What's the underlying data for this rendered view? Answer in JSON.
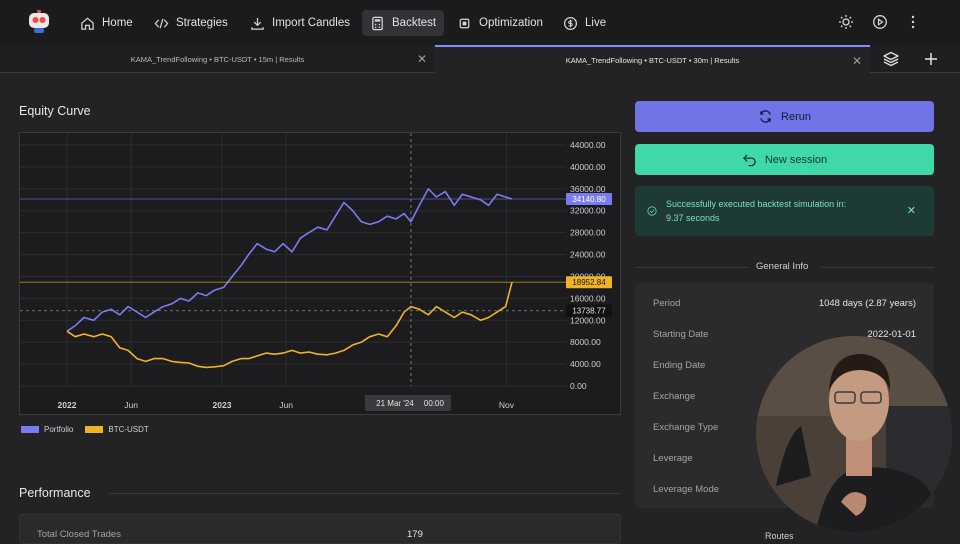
{
  "nav": {
    "home": "Home",
    "strategies": "Strategies",
    "import_candles": "Import Candles",
    "backtest": "Backtest",
    "optimization": "Optimization",
    "live": "Live"
  },
  "tabs": [
    {
      "label": "KAMA_TrendFollowing • BTC-USDT • 15m | Results"
    },
    {
      "label": "KAMA_TrendFollowing • BTC-USDT • 30m | Results"
    }
  ],
  "equity": {
    "title": "Equity Curve"
  },
  "performance": {
    "title": "Performance",
    "rows": [
      {
        "label": "Total Closed Trades",
        "value": "179"
      }
    ]
  },
  "actions": {
    "rerun": "Rerun",
    "new_session": "New session"
  },
  "alert": {
    "line1": "Successfully executed backtest simulation in:",
    "line2": "9.37 seconds"
  },
  "general_info": {
    "title": "General Info",
    "rows": [
      {
        "label": "Period",
        "value": "1048 days (2.87 years)"
      },
      {
        "label": "Starting Date",
        "value": "2022-01-01"
      },
      {
        "label": "Ending Date",
        "value": ""
      },
      {
        "label": "Exchange",
        "value": ""
      },
      {
        "label": "Exchange Type",
        "value": ""
      },
      {
        "label": "Leverage",
        "value": ""
      },
      {
        "label": "Leverage Mode",
        "value": ""
      }
    ]
  },
  "routes": {
    "title": "Routes"
  },
  "colors": {
    "portfolio": "#7b7bf0",
    "btc": "#f0b323",
    "accent_green": "#3fd8a8",
    "accent_purple": "#7074e6"
  },
  "chart_data": {
    "type": "line",
    "x_ticks": [
      "2022",
      "Jun",
      "2023",
      "Jun",
      "21 Mar '24",
      "00:00",
      "Nov"
    ],
    "y_ticks": [
      "44000.00",
      "40000.00",
      "36000.00",
      "32000.00",
      "28000.00",
      "24000.00",
      "20000.00",
      "16000.00",
      "12000.00",
      "8000.00",
      "4000.00",
      "0.00"
    ],
    "ylim": [
      0,
      44000
    ],
    "x_range": [
      "2022-01-01",
      "2024-11-14"
    ],
    "crosshair": {
      "x_label": "21 Mar '24",
      "time_label": "00:00",
      "y_label": "13738.77"
    },
    "price_labels": {
      "portfolio": "34140.80",
      "btc": "18952.84"
    },
    "series": [
      {
        "name": "Portfolio",
        "color": "#7b7bf0",
        "dates": [
          "2022-01-01",
          "2022-01-20",
          "2022-02-10",
          "2022-03-05",
          "2022-03-25",
          "2022-04-15",
          "2022-05-05",
          "2022-05-25",
          "2022-06-15",
          "2022-07-05",
          "2022-07-25",
          "2022-08-15",
          "2022-09-05",
          "2022-09-25",
          "2022-10-15",
          "2022-11-05",
          "2022-11-25",
          "2022-12-15",
          "2023-01-05",
          "2023-01-25",
          "2023-02-15",
          "2023-03-05",
          "2023-03-25",
          "2023-04-15",
          "2023-05-05",
          "2023-05-25",
          "2023-06-15",
          "2023-07-05",
          "2023-07-25",
          "2023-08-15",
          "2023-09-05",
          "2023-09-25",
          "2023-10-15",
          "2023-11-05",
          "2023-11-25",
          "2023-12-15",
          "2024-01-05",
          "2024-01-25",
          "2024-02-15",
          "2024-03-05",
          "2024-03-21",
          "2024-04-10",
          "2024-05-01",
          "2024-05-20",
          "2024-06-10",
          "2024-07-01",
          "2024-07-20",
          "2024-08-10",
          "2024-09-01",
          "2024-09-20",
          "2024-10-10",
          "2024-10-30",
          "2024-11-14"
        ],
        "values": [
          10000,
          11000,
          12500,
          12000,
          13500,
          14000,
          13000,
          14500,
          13500,
          12500,
          13500,
          14500,
          15000,
          16000,
          15500,
          17000,
          16500,
          17500,
          18000,
          20000,
          22000,
          24000,
          26000,
          25000,
          24500,
          26000,
          24500,
          27000,
          28000,
          29000,
          28500,
          31000,
          33500,
          32000,
          30000,
          29500,
          30000,
          31000,
          30500,
          31500,
          30000,
          33000,
          36000,
          34500,
          35500,
          33000,
          35000,
          34500,
          34000,
          33000,
          35000,
          34500,
          34140.8
        ]
      },
      {
        "name": "BTC-USDT",
        "color": "#f0b323",
        "dates": [
          "2022-01-01",
          "2022-01-20",
          "2022-02-10",
          "2022-03-05",
          "2022-03-25",
          "2022-04-15",
          "2022-05-05",
          "2022-05-25",
          "2022-06-15",
          "2022-07-05",
          "2022-07-25",
          "2022-08-15",
          "2022-09-05",
          "2022-09-25",
          "2022-10-15",
          "2022-11-05",
          "2022-11-25",
          "2022-12-15",
          "2023-01-05",
          "2023-01-25",
          "2023-02-15",
          "2023-03-05",
          "2023-03-25",
          "2023-04-15",
          "2023-05-05",
          "2023-05-25",
          "2023-06-15",
          "2023-07-05",
          "2023-07-25",
          "2023-08-15",
          "2023-09-05",
          "2023-09-25",
          "2023-10-15",
          "2023-11-05",
          "2023-11-25",
          "2023-12-15",
          "2024-01-05",
          "2024-01-25",
          "2024-02-15",
          "2024-03-05",
          "2024-03-21",
          "2024-04-10",
          "2024-05-01",
          "2024-05-20",
          "2024-06-10",
          "2024-07-01",
          "2024-07-20",
          "2024-08-10",
          "2024-09-01",
          "2024-09-20",
          "2024-10-10",
          "2024-10-30",
          "2024-11-14"
        ],
        "values": [
          10000,
          9000,
          9500,
          9000,
          9500,
          9000,
          7000,
          6500,
          5000,
          4500,
          5000,
          5000,
          4500,
          4300,
          4200,
          3600,
          3400,
          3500,
          3700,
          4500,
          5000,
          5000,
          5500,
          6000,
          5800,
          6000,
          6500,
          6000,
          6200,
          5800,
          5700,
          6000,
          6500,
          7500,
          8000,
          9000,
          9500,
          9000,
          11000,
          13500,
          14500,
          14000,
          13000,
          14500,
          13500,
          12500,
          13500,
          13000,
          12000,
          12500,
          13500,
          14500,
          18952.84
        ]
      }
    ],
    "legend": [
      "Portfolio",
      "BTC-USDT"
    ],
    "grid": true,
    "legend_position": "bottom-left"
  }
}
